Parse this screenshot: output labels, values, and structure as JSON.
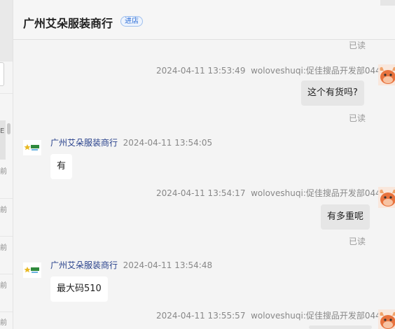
{
  "header": {
    "title": "广州艾朵服装商行",
    "badge": "进店"
  },
  "left_fragments": [
    "前",
    "前",
    "前",
    "前",
    "前"
  ],
  "left_active_fragment": "E",
  "read_status": "已读",
  "messages": [
    {
      "time": "2024-04-11 13:53:49",
      "sender": "woloveshuqi:促佳搜品开发部044",
      "text": "这个有货吗?"
    },
    {
      "time": "2024-04-11 13:54:05",
      "sender": "广州艾朵服装商行",
      "text": "有"
    },
    {
      "time": "2024-04-11 13:54:17",
      "sender": "woloveshuqi:促佳搜品开发部044",
      "text": "有多重呢"
    },
    {
      "time": "2024-04-11 13:54:48",
      "sender": "广州艾朵服装商行",
      "text": "最大码510"
    },
    {
      "time": "2024-04-11 13:55:57",
      "sender": "woloveshuqi:促佳搜品开发部044",
      "text": ""
    }
  ],
  "colors": {
    "shop_name": "#27408b",
    "badge": "#2f6fd6",
    "outgoing_bubble": "#e6e6e6",
    "incoming_bubble": "#ffffff"
  },
  "icons": {
    "shop_avatar": "star-logo-icon",
    "user_avatar": "cartoon-cow-icon"
  }
}
